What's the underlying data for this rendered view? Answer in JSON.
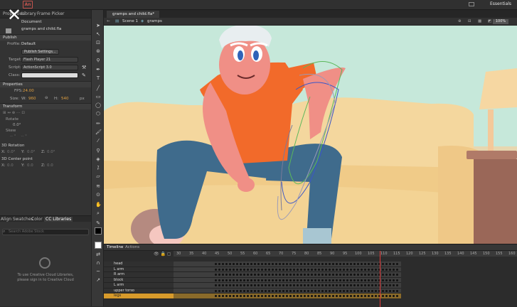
{
  "app": {
    "logo_text": "An",
    "workspace": "Essentials",
    "close_glyph": "✕"
  },
  "left_panel": {
    "tabs": [
      "Properties",
      "Library",
      "Frame Picker"
    ],
    "document_label": "Document",
    "document_name": "gramps and child.fla",
    "publish_header": "Publish",
    "profile_label": "Profile:",
    "profile_value": "Default",
    "publish_settings_button": "Publish Settings...",
    "target_label": "Target:",
    "target_value": "Flash Player 21",
    "script_label": "Script:",
    "script_value": "ActionScript 3.0",
    "class_label": "Class:",
    "properties_header": "Properties",
    "fps_label": "FPS:",
    "fps_value": "24.00",
    "size_label": "Size:",
    "width_label": "W:",
    "width_value": "960",
    "height_label": "H:",
    "height_value": "540",
    "size_unit": "px",
    "transform_header": "Transform",
    "rotate_label": "Rotate",
    "rotate_value": "0.0°",
    "skew_label": "Skew",
    "rotation_3d_label": "3D Rotation",
    "x_label": "X:",
    "x_value": "0.0°",
    "y_label": "Y:",
    "y_value": "0.0°",
    "z_label": "Z:",
    "z_value": "0.0°",
    "center_3d_label": "3D Center point",
    "cx_label": "X:",
    "cx_value": "0.0",
    "cy_label": "Y:",
    "cy_value": "0.0",
    "cz_label": "Z:",
    "cz_value": "0.0",
    "bottom_tabs": [
      "Align",
      "Swatches",
      "Color",
      "CC Libraries"
    ],
    "search_placeholder": "Search Adobe Stock",
    "cc_message_1": "To use Creative Cloud Libraries,",
    "cc_message_2": "please sign in to Creative Cloud"
  },
  "document": {
    "tab_label": "gramps and child.fla*",
    "scene_label": "Scene 1",
    "symbol_label": "gramps",
    "zoom": "100%"
  },
  "timeline": {
    "tabs": [
      "Timeline",
      "Actions"
    ],
    "ruler_ticks": [
      "30",
      "35",
      "40",
      "45",
      "50",
      "55",
      "60",
      "65",
      "70",
      "75",
      "80",
      "85",
      "90",
      "95",
      "100",
      "105",
      "110",
      "115",
      "120",
      "125",
      "130",
      "135",
      "140",
      "145",
      "150",
      "155",
      "160"
    ],
    "layers": [
      "head",
      "L arm",
      "R arm",
      "block",
      "L arm",
      "upper torso",
      "legs"
    ],
    "selected_layer": "legs"
  },
  "colors": {
    "accent": "#d79a2b",
    "playhead": "#e23a3a",
    "stage_bg": "#bfe3d5",
    "shirt": "#f26a2a",
    "skin": "#f08f86",
    "pants": "#3d6b8e",
    "couch": "#f3d49c"
  }
}
